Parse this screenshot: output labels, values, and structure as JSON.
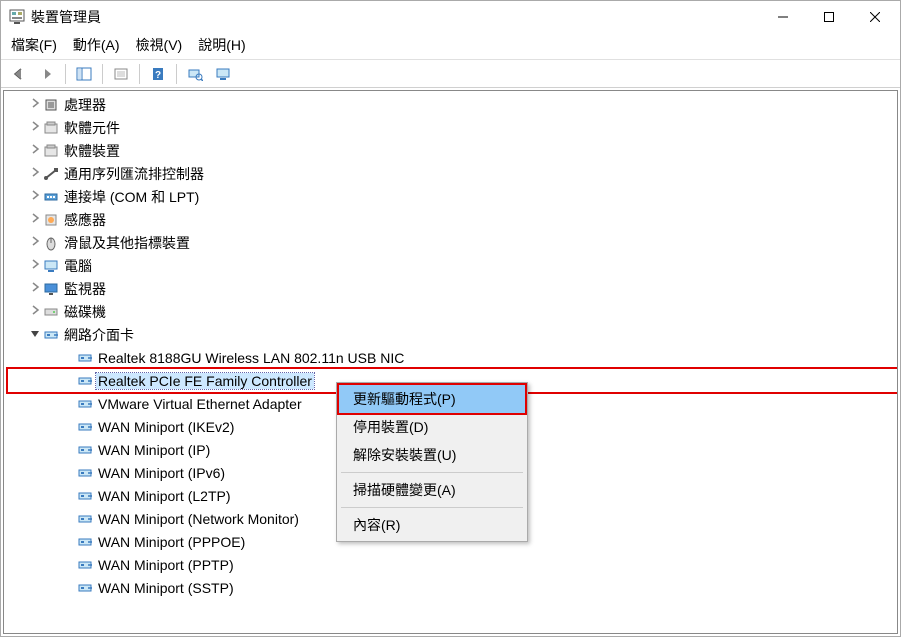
{
  "window": {
    "title": "裝置管理員"
  },
  "menubar": {
    "file": "檔案(F)",
    "action": "動作(A)",
    "view": "檢視(V)",
    "help": "說明(H)"
  },
  "tree": {
    "categories": [
      {
        "label": "處理器",
        "icon": "cpu",
        "expanded": false
      },
      {
        "label": "軟體元件",
        "icon": "sw-comp",
        "expanded": false
      },
      {
        "label": "軟體裝置",
        "icon": "sw-dev",
        "expanded": false
      },
      {
        "label": "通用序列匯流排控制器",
        "icon": "usb",
        "expanded": false
      },
      {
        "label": "連接埠 (COM 和 LPT)",
        "icon": "port",
        "expanded": false
      },
      {
        "label": "感應器",
        "icon": "sensor",
        "expanded": false
      },
      {
        "label": "滑鼠及其他指標裝置",
        "icon": "mouse",
        "expanded": false
      },
      {
        "label": "電腦",
        "icon": "computer",
        "expanded": false
      },
      {
        "label": "監視器",
        "icon": "monitor",
        "expanded": false
      },
      {
        "label": "磁碟機",
        "icon": "disk",
        "expanded": false
      },
      {
        "label": "網路介面卡",
        "icon": "network",
        "expanded": true
      }
    ],
    "network_children": [
      {
        "label": "Realtek 8188GU Wireless LAN 802.11n USB NIC",
        "selected": false,
        "highlighted": false
      },
      {
        "label": "Realtek PCIe FE Family Controller",
        "selected": true,
        "highlighted": true
      },
      {
        "label": "VMware Virtual Ethernet Adapter",
        "selected": false,
        "highlighted": false
      },
      {
        "label": "WAN Miniport (IKEv2)",
        "selected": false,
        "highlighted": false
      },
      {
        "label": "WAN Miniport (IP)",
        "selected": false,
        "highlighted": false
      },
      {
        "label": "WAN Miniport (IPv6)",
        "selected": false,
        "highlighted": false
      },
      {
        "label": "WAN Miniport (L2TP)",
        "selected": false,
        "highlighted": false
      },
      {
        "label": "WAN Miniport (Network Monitor)",
        "selected": false,
        "highlighted": false
      },
      {
        "label": "WAN Miniport (PPPOE)",
        "selected": false,
        "highlighted": false
      },
      {
        "label": "WAN Miniport (PPTP)",
        "selected": false,
        "highlighted": false
      },
      {
        "label": "WAN Miniport (SSTP)",
        "selected": false,
        "highlighted": false
      }
    ]
  },
  "context_menu": {
    "items": [
      {
        "label": "更新驅動程式(P)",
        "selected": true,
        "highlighted": true
      },
      {
        "label": "停用裝置(D)",
        "selected": false
      },
      {
        "label": "解除安裝裝置(U)",
        "selected": false
      },
      {
        "sep": true
      },
      {
        "label": "掃描硬體變更(A)",
        "selected": false
      },
      {
        "sep": true
      },
      {
        "label": "內容(R)",
        "selected": false
      }
    ]
  }
}
